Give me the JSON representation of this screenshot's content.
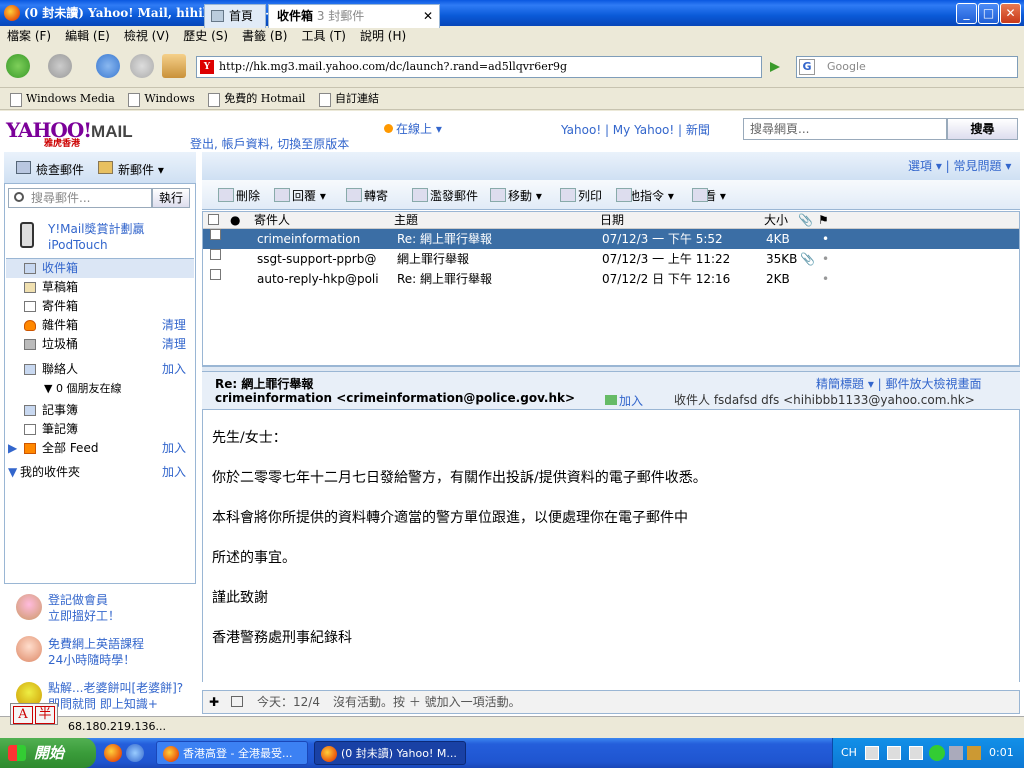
{
  "window": {
    "title": "(0 封未讀) Yahoo! Mail, hihibbb1133 - Mozilla Firefox",
    "min": "_",
    "max": "□",
    "close": "✕"
  },
  "menu": [
    "檔案 (F)",
    "編輯 (E)",
    "檢視 (V)",
    "歷史 (S)",
    "書籤 (B)",
    "工具 (T)",
    "說明 (H)"
  ],
  "nav": {
    "url": "http://hk.mg3.mail.yahoo.com/dc/launch?.rand=ad5llqvr6er9g",
    "search_placeholder": "Google",
    "favicon": "Y"
  },
  "bookmarks": [
    "Windows Media",
    "Windows",
    "免費的 Hotmail",
    "自訂連結"
  ],
  "yahoo": {
    "logo": "YAHOO!",
    "logo_mail": "MAIL",
    "logo_sub": "雅虎香港",
    "top_links": "登出, 帳戶資料, 切換至原版本",
    "status": "在線上 ▾",
    "links": "Yahoo! | My Yahoo! | 新聞",
    "web_search_placeholder": "搜尋網頁...",
    "web_search_btn": "搜尋"
  },
  "sidebar": {
    "check_mail": "檢查郵件",
    "new_mail": "新郵件 ▾",
    "search_placeholder": "搜尋郵件...",
    "search_btn": "執行",
    "promo": [
      "Y!Mail獎賞計劃贏",
      "iPodTouch"
    ],
    "folders": [
      {
        "label": "收件箱",
        "right": ""
      },
      {
        "label": "草稿箱",
        "right": ""
      },
      {
        "label": "寄件箱",
        "right": ""
      },
      {
        "label": "雜件箱",
        "right": "清理"
      },
      {
        "label": "垃圾桶",
        "right": "清理"
      },
      {
        "label": "聯絡人",
        "right": "加入"
      },
      {
        "label": "▼ 0 個朋友在線",
        "right": ""
      },
      {
        "label": "記事簿",
        "right": ""
      },
      {
        "label": "筆記簿",
        "right": ""
      },
      {
        "label": "全部 Feed",
        "right": "加入"
      },
      {
        "label": "我的收件夾",
        "right": "加入"
      }
    ],
    "promos_bottom": [
      [
        "登記做會員",
        "立即搵好工！"
      ],
      [
        "免費網上英語課程",
        "24小時隨時學！"
      ],
      [
        "點解...老婆餅叫[老婆餅]?",
        "即問就問 即上知識+"
      ]
    ]
  },
  "tabs": {
    "home": "首頁",
    "inbox": "收件箱",
    "inbox_count": "3 封郵件",
    "close": "✕",
    "right": "選項 ▾ | 常見問題 ▾"
  },
  "toolbar": [
    "刪除",
    "回覆 ▾",
    "轉寄",
    "濫發郵件",
    "移動 ▾",
    "列印",
    "其他指令 ▾",
    "查看 ▾"
  ],
  "list_headers": {
    "from": "寄件人",
    "subject": "主題",
    "date": "日期",
    "size": "大小"
  },
  "messages": [
    {
      "from": "crimeinformation",
      "subject": "Re: 網上罪行舉報",
      "date": "07/12/3 一 下午 5:52",
      "size": "4KB",
      "attach": ""
    },
    {
      "from": "ssgt-support-pprb@",
      "subject": "網上罪行舉報",
      "date": "07/12/3 一 上午 11:22",
      "size": "35KB",
      "attach": "📎"
    },
    {
      "from": "auto-reply-hkp@poli",
      "subject": "Re: 網上罪行舉報",
      "date": "07/12/2 日 下午 12:16",
      "size": "2KB",
      "attach": ""
    }
  ],
  "reading": {
    "subject": "Re: 網上罪行舉報",
    "from": "crimeinformation <crimeinformation@police.gov.hk>",
    "add_contact": "加入",
    "recipient": "收件人  fsdafsd dfs <hihibbb1133@yahoo.com.hk>",
    "right": "精簡標題 ▾ | 郵件放大檢視畫面",
    "body": [
      "先生/女士：",
      "你於二零零七年十二月七日發給警方，有關作出投訴/提供資料的電子郵件收悉。",
      "本科會將你所提供的資料轉介適當的警方單位跟進，以便處理你在電子郵件中",
      "所述的事宜。",
      "謹此致謝",
      "香港警務處刑事紀錄科"
    ]
  },
  "calendar": {
    "today": "今天：12/4",
    "text": "沒有活動。按 ＋ 號加入一項活動。"
  },
  "statusbar": {
    "ip": "68.180.219.136...",
    "ime_a": "A",
    "ime_b": "半"
  },
  "taskbar": {
    "start": "開始",
    "tasks": [
      "香港高登 - 全港最受...",
      "(0 封未讀) Yahoo! M..."
    ],
    "tray_lang": "CH",
    "clock": "0:01"
  }
}
